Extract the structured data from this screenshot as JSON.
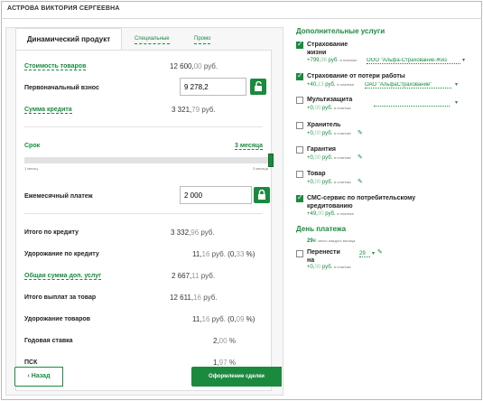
{
  "header": {
    "title": "АСТРОВА ВИКТОРИЯ СЕРГЕЕВНА"
  },
  "tabs": [
    {
      "label": "Динамический продукт"
    },
    {
      "label": "Специальные"
    },
    {
      "label": "Промо"
    }
  ],
  "form": {
    "goods_cost": {
      "label": "Стоимость товаров",
      "int": "12 600,",
      "dec": "00",
      "cur": "руб."
    },
    "down_payment": {
      "label": "Первоначальный взнос",
      "value": "9 278,2"
    },
    "credit_sum": {
      "label": "Сумма кредита",
      "int": "3 321,",
      "dec": "79",
      "cur": "руб."
    },
    "term": {
      "label": "Срок",
      "value": "3 месяца",
      "min_label": "1 месяц",
      "max_label": "3 месяца",
      "position": 1.0
    },
    "monthly": {
      "label": "Ежемесячный платеж",
      "value": "2 000"
    }
  },
  "summary": {
    "total_credit": {
      "label": "Итого по кредиту",
      "int": "3 332,",
      "dec": "96",
      "cur": "руб."
    },
    "credit_markup": {
      "label": "Удорожание по кредиту",
      "int": "11,",
      "dec": "16",
      "cur": "руб.",
      "pct_open": "(0,",
      "pct_dec": "33",
      "pct_close": "%)"
    },
    "services_total": {
      "label": "Общая сумма доп. услуг",
      "int": "2 667,",
      "dec": "11",
      "cur": "руб."
    },
    "total_paid": {
      "label": "Итого выплат за товар",
      "int": "12 611,",
      "dec": "16",
      "cur": "руб."
    },
    "goods_markup": {
      "label": "Удорожание товаров",
      "int": "11,",
      "dec": "16",
      "cur": "руб.",
      "pct_open": "(0,",
      "pct_dec": "09",
      "pct_close": "%)"
    },
    "annual_rate": {
      "label": "Годовая ставка",
      "int": "2,",
      "dec": "00",
      "cur": "%"
    },
    "psk": {
      "label": "ПСК",
      "int": "1,",
      "dec": "97",
      "cur": "%"
    }
  },
  "buttons": {
    "back": "Назад",
    "submit": "Оформление сделки"
  },
  "services": {
    "title": "Дополнительные услуги",
    "items": [
      {
        "label1": "Страхование",
        "label2": "жизни",
        "checked": true,
        "price_int": "+799,",
        "price_dec": "98",
        "price_cur": "руб.",
        "note": "в платеже",
        "select": "ООО \"Альфа-Страхование-Жиз"
      },
      {
        "label1": "Страхование от потери работы",
        "label2": "",
        "checked": true,
        "price_int": "+40,",
        "price_dec": "13",
        "price_cur": "руб.",
        "note": "в платеже",
        "select": "ОАО \"АльфаСтрахование\""
      },
      {
        "label1": "Мультизащита",
        "label2": "",
        "checked": false,
        "price_int": "+0,",
        "price_dec": "00",
        "price_cur": "руб.",
        "note": "в платеже",
        "select": ""
      },
      {
        "label1": "Хранитель",
        "label2": "",
        "checked": false,
        "price_int": "+0,",
        "price_dec": "00",
        "price_cur": "руб.",
        "note": "в платеже",
        "select": ""
      },
      {
        "label1": "Гарантия",
        "label2": "",
        "checked": false,
        "price_int": "+0,",
        "price_dec": "00",
        "price_cur": "руб.",
        "note": "в платеже",
        "select": ""
      },
      {
        "label1": "Товар",
        "label2": "",
        "checked": false,
        "price_int": "+0,",
        "price_dec": "00",
        "price_cur": "руб.",
        "note": "в платеже",
        "select": ""
      },
      {
        "label1": "СМС-сервис по потребительскому",
        "label2": "кредитованию",
        "checked": true,
        "price_int": "+49,",
        "price_dec": "00",
        "price_cur": "руб.",
        "note": "в платеже",
        "select": ""
      }
    ]
  },
  "payment_day": {
    "title": "День платежа",
    "day": "29",
    "day_suffix": "е",
    "note": "число каждого месяца",
    "transfer_label1": "Перенести",
    "transfer_label2": "на",
    "transfer_value": "29",
    "transfer_price_int": "+0,",
    "transfer_price_dec": "00",
    "transfer_price_cur": "руб.",
    "transfer_note": "в платеже"
  },
  "colors": {
    "accent": "#1b8a3f",
    "border": "#dedede"
  }
}
